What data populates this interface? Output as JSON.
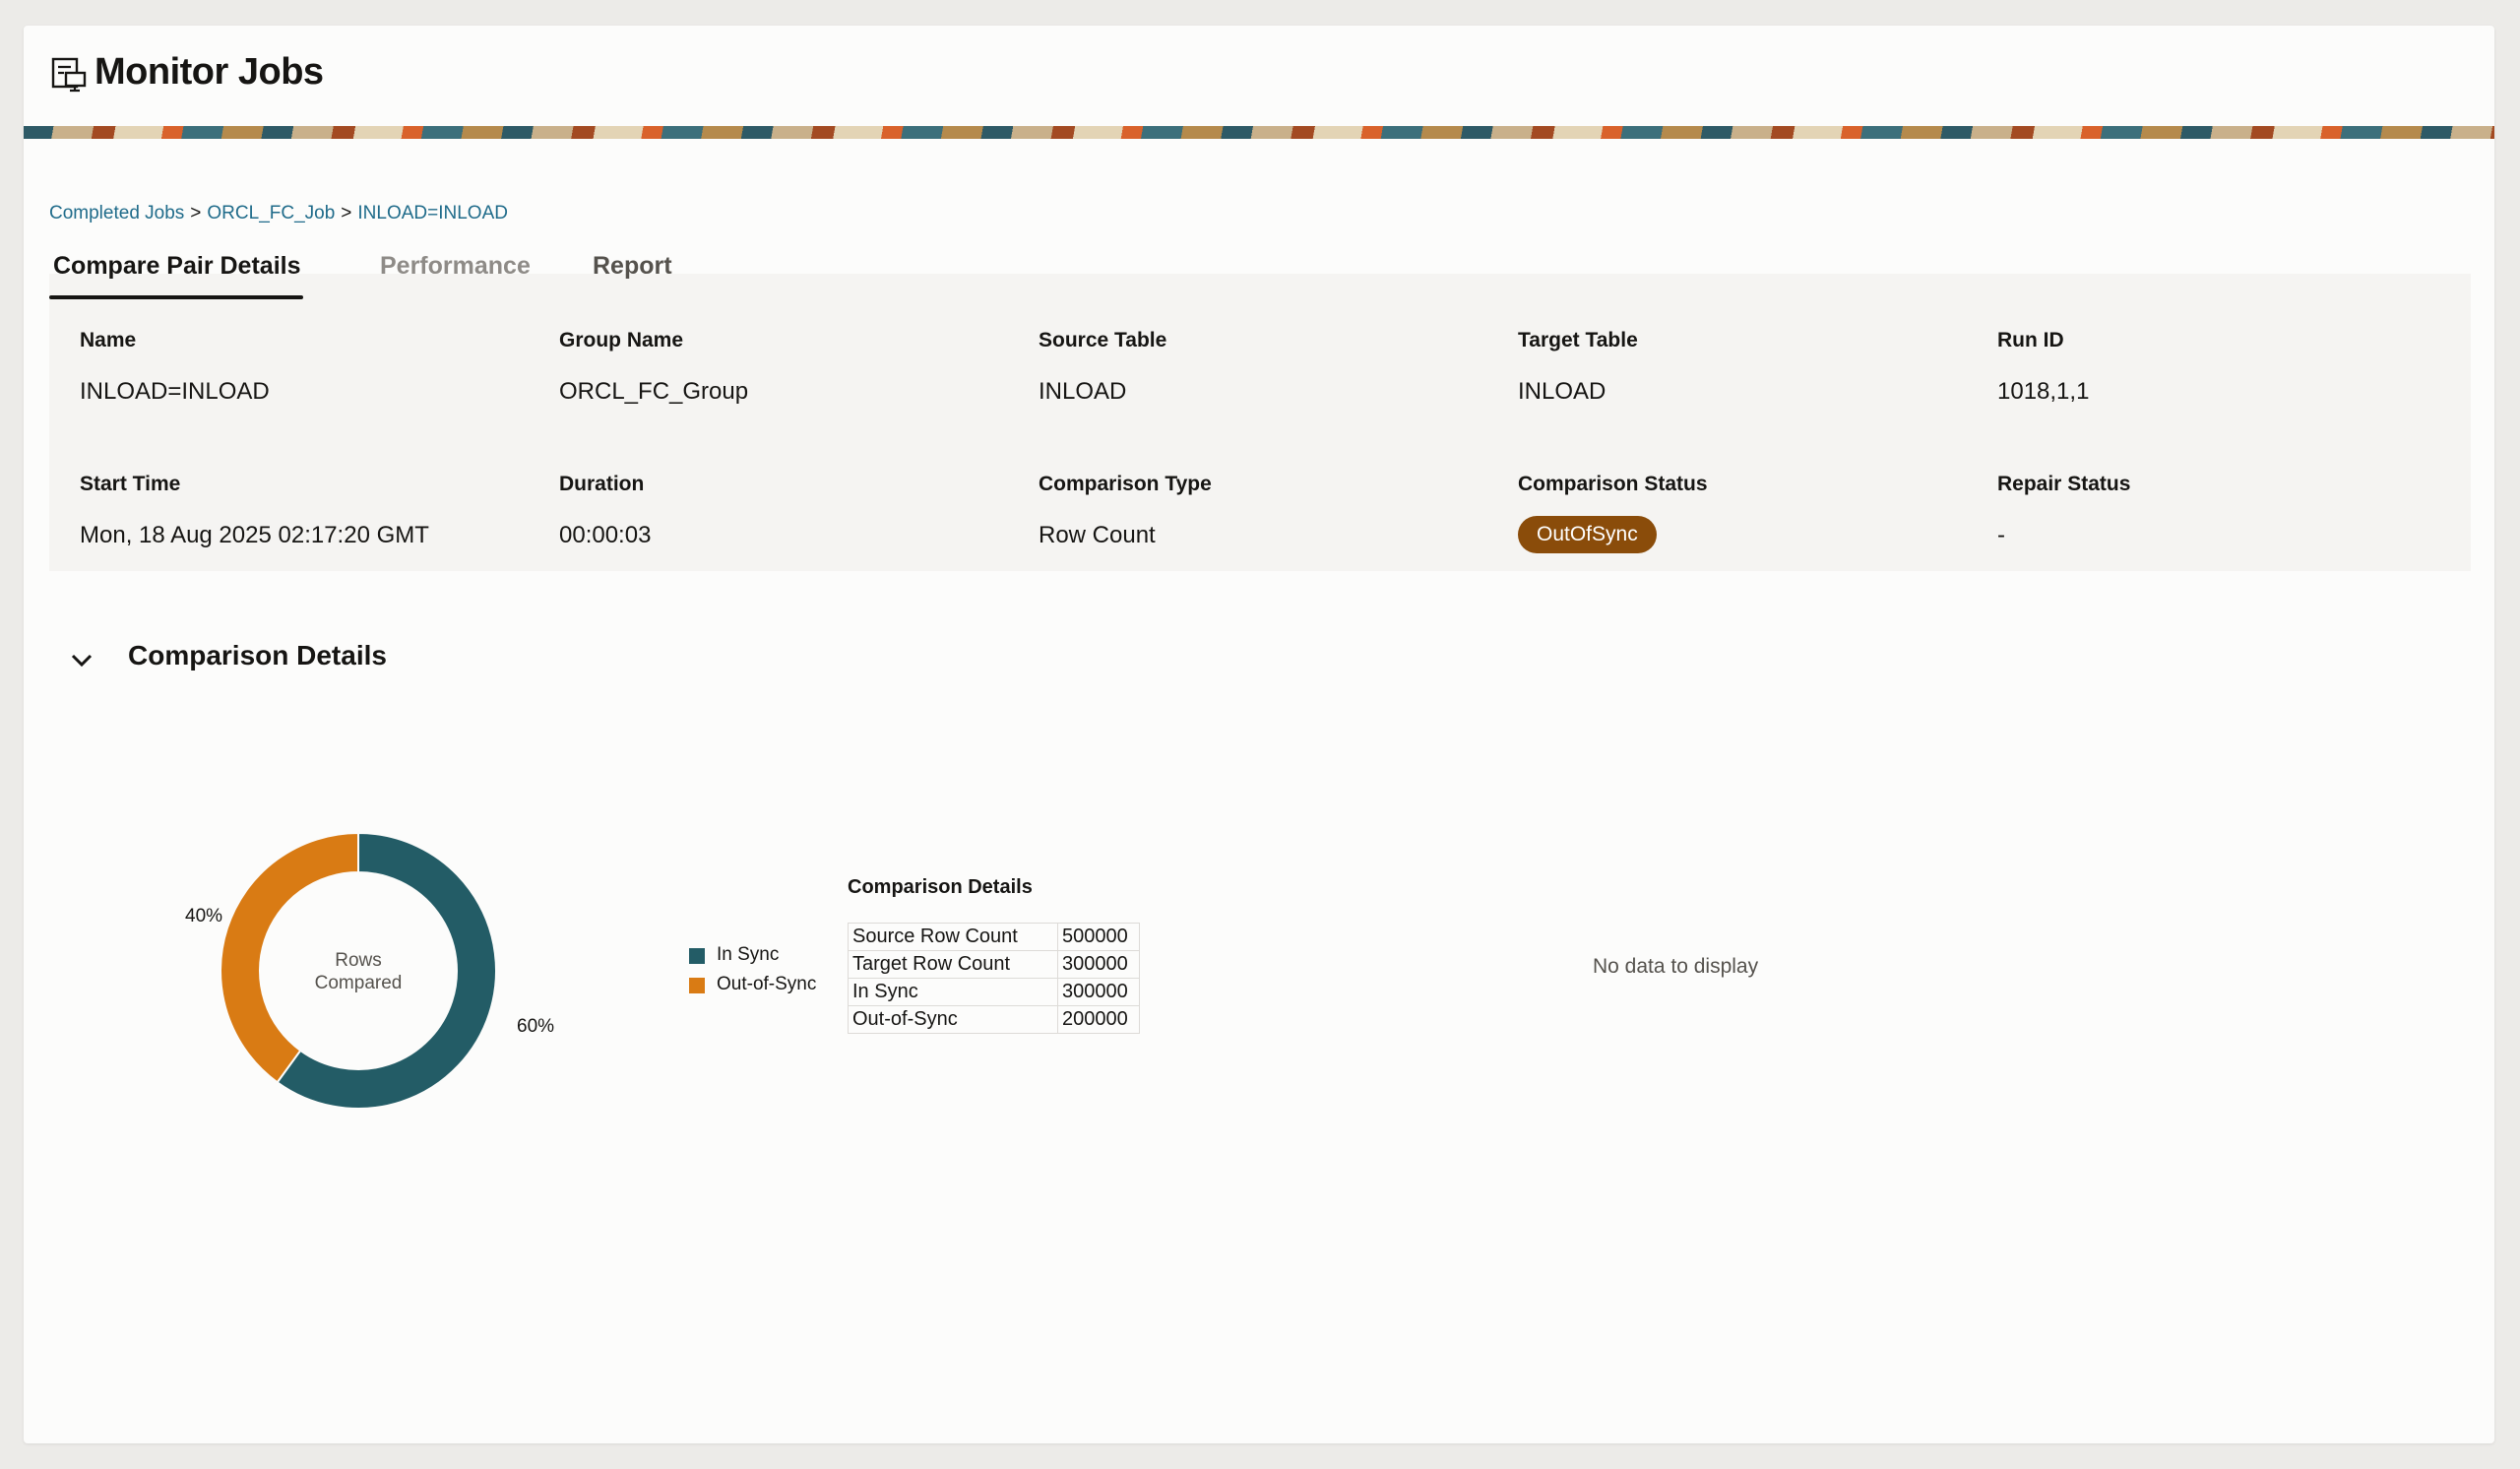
{
  "header": {
    "title": "Monitor Jobs",
    "icon": "monitor-jobs-icon"
  },
  "breadcrumb": {
    "items": [
      "Completed Jobs",
      "ORCL_FC_Job",
      "INLOAD=INLOAD"
    ],
    "separator": ">"
  },
  "tabs": [
    {
      "label": "Compare Pair Details",
      "active": true
    },
    {
      "label": "Performance",
      "active": false
    },
    {
      "label": "Report",
      "active": false
    }
  ],
  "details": {
    "name": {
      "label": "Name",
      "value": "INLOAD=INLOAD"
    },
    "group_name": {
      "label": "Group Name",
      "value": "ORCL_FC_Group"
    },
    "source_table": {
      "label": "Source Table",
      "value": "INLOAD"
    },
    "target_table": {
      "label": "Target Table",
      "value": "INLOAD"
    },
    "run_id": {
      "label": "Run ID",
      "value": "1018,1,1"
    },
    "start_time": {
      "label": "Start Time",
      "value": "Mon, 18 Aug 2025 02:17:20 GMT"
    },
    "duration": {
      "label": "Duration",
      "value": "00:00:03"
    },
    "comparison_type": {
      "label": "Comparison Type",
      "value": "Row Count"
    },
    "comparison_status": {
      "label": "Comparison Status",
      "value": "OutOfSync",
      "color": "#8a4c0a"
    },
    "repair_status": {
      "label": "Repair Status",
      "value": "-"
    }
  },
  "comparison_section": {
    "title": "Comparison Details",
    "expanded": true,
    "donut_center": [
      "Rows",
      "Compared"
    ],
    "table_title": "Comparison Details",
    "table_rows": [
      [
        "Source Row Count",
        "500000"
      ],
      [
        "Target Row Count",
        "300000"
      ],
      [
        "In Sync",
        "300000"
      ],
      [
        "Out-of-Sync",
        "200000"
      ]
    ],
    "no_data_text": "No data to display"
  },
  "chart_data": {
    "type": "pie",
    "donut": true,
    "series": [
      {
        "name": "In Sync",
        "value": 60,
        "label": "60%",
        "color": "#235c66"
      },
      {
        "name": "Out-of-Sync",
        "value": 40,
        "label": "40%",
        "color": "#d97b14"
      }
    ],
    "legend": "right"
  }
}
